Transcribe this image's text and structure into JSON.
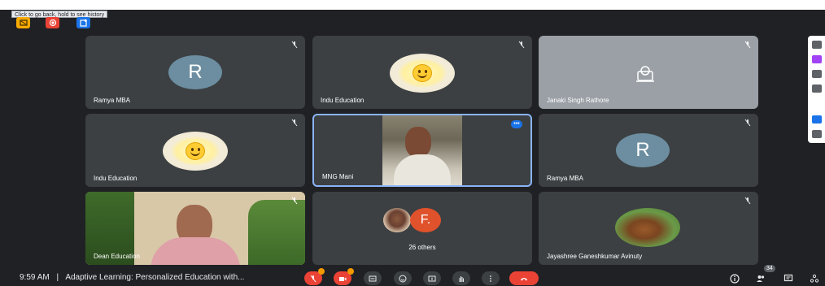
{
  "browser": {
    "tooltip": "Click to go back, hold to see history"
  },
  "top_controls": [
    {
      "name": "cast-icon",
      "color": "#f9ab00"
    },
    {
      "name": "record-icon",
      "color": "#ea4335"
    },
    {
      "name": "add-to-screen-icon",
      "color": "#1a73e8"
    }
  ],
  "tiles": {
    "t1": {
      "name": "Ramya MBA",
      "initial": "R"
    },
    "t2": {
      "name": "Indu Education"
    },
    "t3": {
      "name": "Janaki Singh Rathore"
    },
    "t4": {
      "name": "Indu Education"
    },
    "t5": {
      "name": "MNG Mani"
    },
    "t6": {
      "name": "Ramya MBA",
      "initial": "R"
    },
    "t7": {
      "name": "Dean Education"
    },
    "t8": {
      "others": "26 others",
      "initial": "F."
    },
    "t9": {
      "name": "Jayashree Ganeshkumar Avinuty"
    }
  },
  "bottom": {
    "time": "9:59 AM",
    "separator": "|",
    "meeting_title": "Adaptive Learning: Personalized Education with...",
    "participant_count": "34"
  },
  "colors": {
    "background": "#202124",
    "tile": "#3c4043",
    "active_border": "#8ab4f8",
    "end_call": "#ea4335",
    "avatar_r": "#6c8ea0",
    "avatar_f": "#e0522c"
  }
}
